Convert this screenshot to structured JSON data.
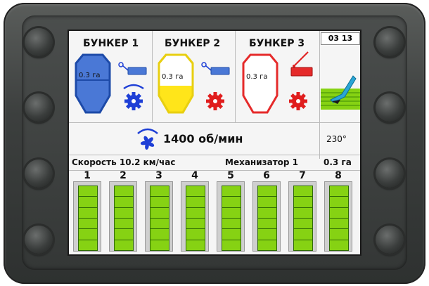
{
  "screen": {
    "time": "03 13",
    "hoppers": [
      {
        "title": "БУНКЕР 1",
        "value": "0.3 га",
        "color": "#4a78d6",
        "fill_level": 1.0
      },
      {
        "title": "БУНКЕР 2",
        "value": "0.3 га",
        "color": "#ffe51a",
        "fill_level": 0.5
      },
      {
        "title": "БУНКЕР 3",
        "value": "0.3 га",
        "color": "#e52a2a",
        "fill_level": 0.0
      }
    ],
    "fan_speed": "1400 об/мин",
    "angle": "230°",
    "speed_label": "Скорость 10.2 км/час",
    "operator": "Механизатор 1",
    "area": "0.3 га",
    "rows": [
      "1",
      "2",
      "3",
      "4",
      "5",
      "6",
      "7",
      "8"
    ],
    "colors": {
      "ok_green": "#86d213",
      "blue": "#1e3fd6",
      "red": "#e01e1e"
    }
  }
}
